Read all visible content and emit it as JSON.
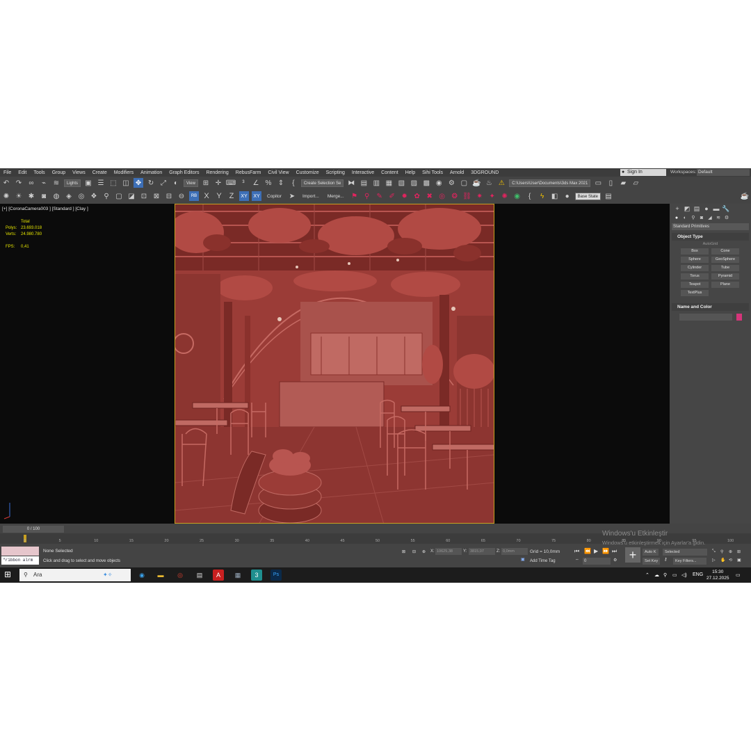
{
  "menu": [
    "File",
    "Edit",
    "Tools",
    "Group",
    "Views",
    "Create",
    "Modifiers",
    "Animation",
    "Graph Editors",
    "Rendering",
    "RebusFarm",
    "Civil View",
    "Customize",
    "Scripting",
    "Interactive",
    "Content",
    "Help",
    "Sihi Tools",
    "Arnold",
    "3DGROUND"
  ],
  "signin": "Sign In",
  "workspaces_label": "Workspaces:",
  "workspaces_value": "Default",
  "toolbar": {
    "lights": "Lights",
    "view": "View",
    "selection_set": "Create Selection Se",
    "path": "C:\\Users\\User\\Documents\\3ds Max 2021",
    "rb": "RB",
    "xy1": "XY",
    "xy2": "XY",
    "x": "X",
    "y": "Y",
    "z": "Z",
    "copitor": "Copitor",
    "import": "Import...",
    "merge": "Merge...",
    "base_state": "Base State"
  },
  "viewport": {
    "label": "[+] [CoronaCamera003 ] [Standard ] [Clay ]",
    "total": "Total",
    "polys_label": "Polys:",
    "polys": "23.693.018",
    "verts_label": "Verts:",
    "verts": "24.980.780",
    "fps_label": "FPS:",
    "fps": "0,41"
  },
  "command_panel": {
    "dropdown": "Standard Primitives",
    "object_type": "Object Type",
    "autogrid": "AutoGrid",
    "objects": [
      "Box",
      "Cone",
      "Sphere",
      "GeoSphere",
      "Cylinder",
      "Tube",
      "Torus",
      "Pyramid",
      "Teapot",
      "Plane",
      "TextPlus"
    ],
    "name_and_color": "Name and Color",
    "swatch_color": "#d5357a"
  },
  "timeline": {
    "slider": "0 / 100",
    "ticks": [
      "0",
      "5",
      "10",
      "15",
      "20",
      "25",
      "30",
      "35",
      "40",
      "45",
      "50",
      "55",
      "60",
      "65",
      "70",
      "75",
      "80",
      "85",
      "90",
      "95",
      "100"
    ]
  },
  "watermark": {
    "line1": "Windows'u Etkinleştir",
    "line2": "Windows'u etkinleştirmek için Ayarlar'a gidin."
  },
  "status": {
    "maxscript": "\"ribbon alrm",
    "none_selected": "None Selected",
    "hint": "Click and drag to select and move objects",
    "x_label": "X:",
    "x_val": "10625,38",
    "y_label": "Y:",
    "y_val": "3815,07",
    "z_label": "Z:",
    "z_val": "0,0mm",
    "grid": "Grid = 10,0mm",
    "time_tag": "Add Time Tag",
    "frame": "0",
    "auto_key": "Auto K",
    "selected": "Selected",
    "set_key": "Set Key",
    "key_filters": "Key Filters..."
  },
  "taskbar": {
    "search": "Ara",
    "lang": "ENG",
    "time": "15:30",
    "date": "27.12.2025"
  }
}
